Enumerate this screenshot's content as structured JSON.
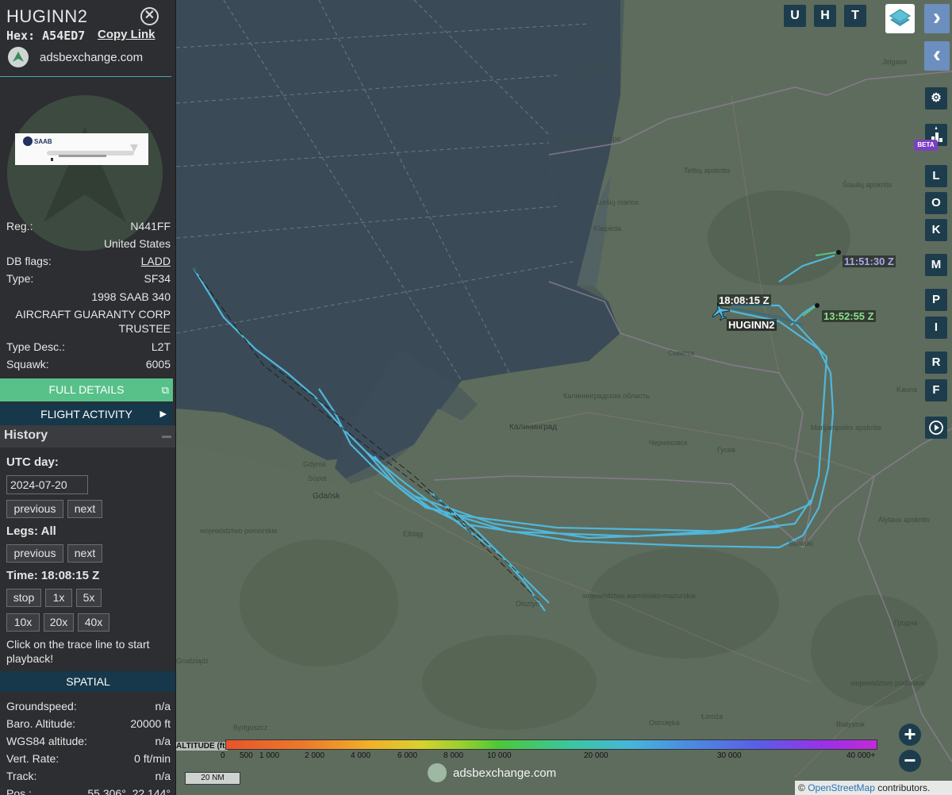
{
  "sidebar": {
    "callsign": "HUGINN2",
    "hex_label": "Hex:",
    "hex": "A54ED7",
    "copy_link": "Copy Link",
    "brand": "adsbexchange.com",
    "info": {
      "reg_label": "Reg.:",
      "reg": "N441FF",
      "country": "United States",
      "db_flags_label": "DB flags:",
      "db_flags": "LADD",
      "type_label": "Type:",
      "type": "SF34",
      "model": "1998 SAAB 340",
      "owner_line1": "AIRCRAFT GUARANTY CORP",
      "owner_line2": "TRUSTEE",
      "type_desc_label": "Type Desc.:",
      "type_desc": "L2T",
      "squawk_label": "Squawk:",
      "squawk": "6005"
    },
    "full_details": "FULL DETAILS",
    "flight_activity": "FLIGHT ACTIVITY",
    "history": {
      "title": "History",
      "utc_day_label": "UTC day:",
      "utc_day": "2024-07-20",
      "previous": "previous",
      "next": "next",
      "legs_label": "Legs: All",
      "time_label": "Time: 18:08:15 Z",
      "speed_buttons": [
        "stop",
        "1x",
        "5x",
        "10x",
        "20x",
        "40x"
      ],
      "hint": "Click on the trace line to start playback!"
    },
    "spatial": {
      "title": "SPATIAL",
      "rows": [
        {
          "label": "Groundspeed:",
          "value": "n/a"
        },
        {
          "label": "Baro. Altitude:",
          "value": "20000 ft"
        },
        {
          "label": "WGS84 altitude:",
          "value": "n/a"
        },
        {
          "label": "Vert. Rate:",
          "value": "0 ft/min"
        },
        {
          "label": "Track:",
          "value": "n/a"
        },
        {
          "label": "Pos.:",
          "value": "55.306°, 22.144°"
        }
      ]
    }
  },
  "map": {
    "places": {
      "liepaja": "Liepāja",
      "jelgava": "Jelgava",
      "klaipeda": "Klaipėda",
      "telsiu": "Telšių apskritis",
      "siauliu": "Šiaulių apskritis",
      "kaliningrad": "Калининград",
      "kaliningrad_obl": "Калининградская область",
      "sovetsk": "Советск",
      "chernyakhovsk": "Черняховск",
      "gusev": "Гусев",
      "gdynia": "Gdynia",
      "sopot": "Sopot",
      "gdansk": "Gdańsk",
      "elblag": "Elbląg",
      "pomorskie": "województwo pomorskie",
      "warminsko": "województwo warmińsko-mazurskie",
      "olsztyn": "Olsztyn",
      "suwalki": "Suwałki",
      "grudziadz": "Grudziądz",
      "bydgoszcz": "Bydgoszcz",
      "ostroleka": "Ostrołęka",
      "lomza": "Łomża",
      "bialystok": "Białystok",
      "podlaskie": "województwo podlaskie",
      "grodno": "Гродна",
      "kaunas": "Kauna",
      "alytus": "Alytaus apskritis",
      "marijampole": "Marijampolės apskritis",
      "kursiu": "Kuršių marios",
      "dabos": "dabos parks Pape"
    },
    "aircraft_label": "HUGINN2",
    "time_labels": {
      "current": "18:08:15 Z",
      "first": "11:51:30 Z",
      "second": "13:52:55 Z"
    },
    "top_buttons": [
      "U",
      "H",
      "T"
    ],
    "nav_buttons": {
      "forward": "›",
      "back": "‹"
    },
    "right_buttons": [
      "L",
      "O",
      "K",
      "M",
      "P",
      "I",
      "R",
      "F"
    ],
    "beta": "BETA",
    "altitude_legend": {
      "title": "ALTITUDE (ft)",
      "ticks": [
        "0",
        "500",
        "1 000",
        "2 000",
        "4 000",
        "6 000",
        "8 000",
        "10 000",
        "20 000",
        "30 000",
        "40 000+"
      ]
    },
    "scale_label": "20 NM",
    "brand": "adsbexchange.com",
    "zoom_in": "+",
    "zoom_out": "−",
    "attribution_prefix": "©",
    "attribution_link": "OpenStreetMap",
    "attribution_suffix": "contributors."
  }
}
